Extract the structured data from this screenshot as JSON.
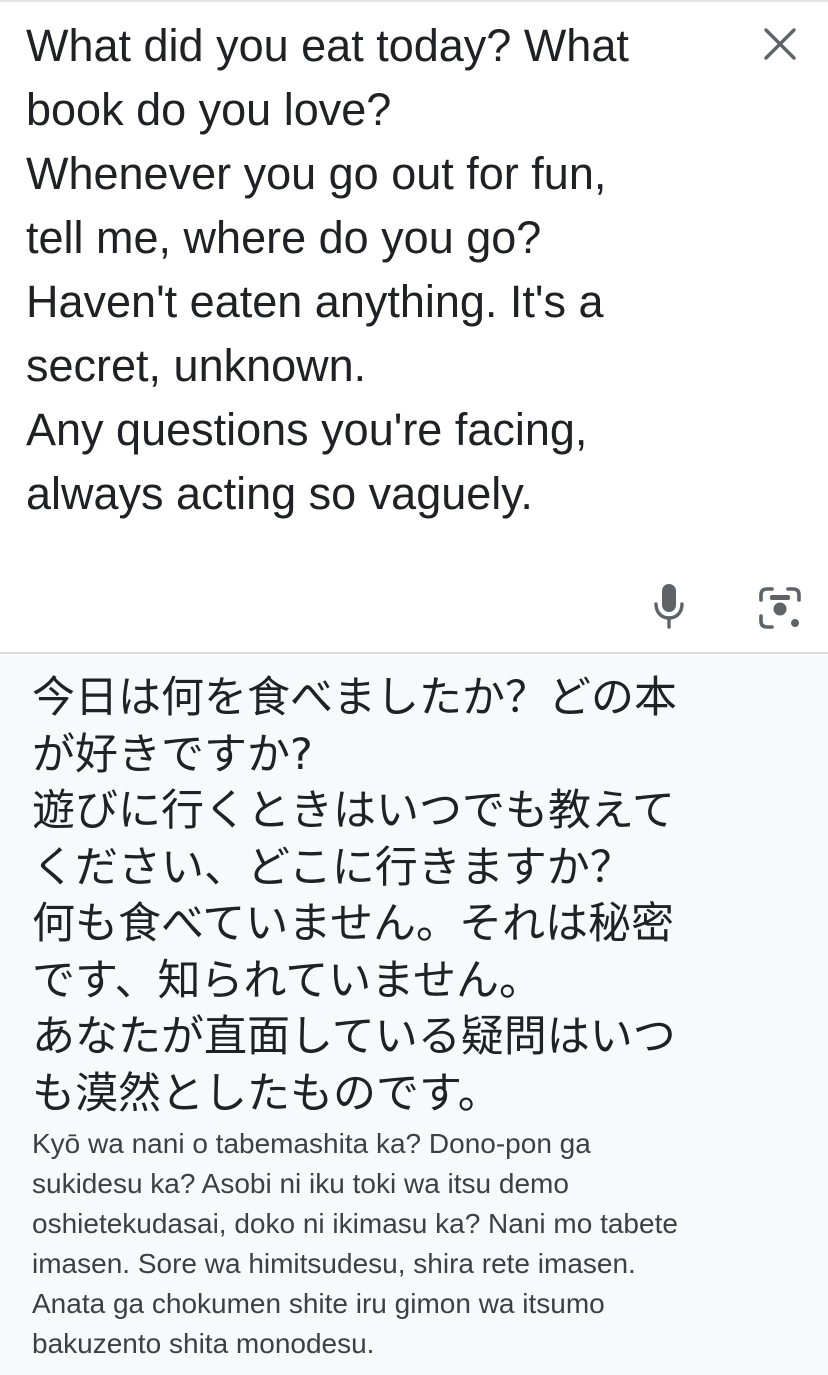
{
  "source": {
    "lines": [
      "What did you eat today? What",
      "book do you love?",
      "Whenever you go out for fun,",
      "tell me, where do you go?",
      "Haven't eaten anything. It's a",
      "secret, unknown.",
      "Any questions you're facing,",
      "always acting so vaguely."
    ],
    "close_icon": "close-icon",
    "mic_icon": "microphone-icon",
    "lens_icon": "camera-lens-icon"
  },
  "translation": {
    "lines": [
      "今日は何を食べましたか？どの本",
      "が好きですか?",
      "遊びに行くときはいつでも教えて",
      "ください、どこに行きますか？",
      "何も食べていません。それは秘密",
      "です、知られていません。",
      "あなたが直面している疑問はいつ",
      "も漠然としたものです。"
    ],
    "romanization_lines": [
      "Kyō wa nani o tabemashita ka? Dono-pon ga",
      "sukidesu ka? Asobi ni iku toki wa itsu demo",
      "oshietekudasai, doko ni ikimasu ka? Nani mo tabete",
      "imasen. Sore wa himitsudesu, shira rete imasen.",
      "Anata ga chokumen shite iru gimon wa itsumo",
      "bakuzento shita monodesu."
    ]
  },
  "colors": {
    "text": "#202124",
    "secondary_text": "#3c4043",
    "icon": "#5f6368",
    "result_background": "#f8f9fa",
    "source_background": "#ffffff",
    "divider": "#dadce0"
  }
}
